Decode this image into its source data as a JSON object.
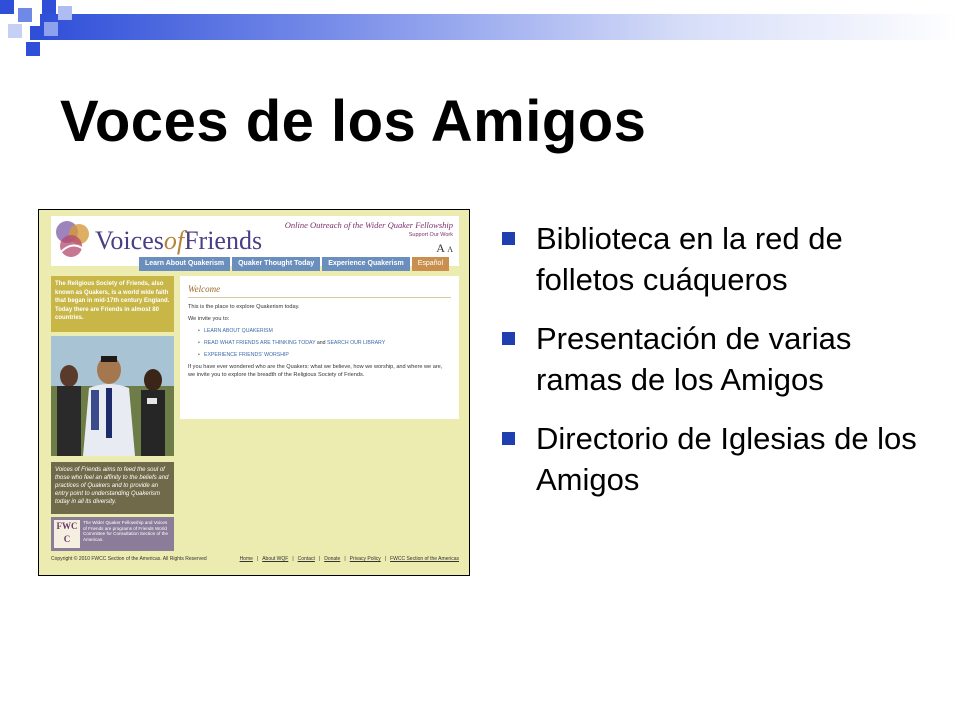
{
  "slide": {
    "title": "Voces de los Amigos",
    "accent_color": "#1f3fb0",
    "bullets": [
      {
        "text": "Biblioteca en la red de folletos cuáqueros"
      },
      {
        "text": "Presentación de varias ramas de los Amigos"
      },
      {
        "text": "Directorio de Iglesias de los Amigos"
      }
    ]
  },
  "website": {
    "logo_prefix": "Voices",
    "logo_of": "of",
    "logo_suffix": "Friends",
    "tagline": "Online Outreach of the Wider Quaker Fellowship",
    "support_link": "Support Our Work",
    "font_size_large": "A",
    "font_size_small": "A",
    "nav": [
      {
        "label": "Learn About Quakerism"
      },
      {
        "label": "Quaker Thought Today"
      },
      {
        "label": "Experience Quakerism"
      },
      {
        "label": "Español"
      }
    ],
    "intro_text": "The Religious Society of Friends, also known as Quakers, is a world wide faith that began in mid-17th century England. Today there are Friends in almost 80 countries.",
    "welcome_heading": "Welcome",
    "explore_line": "This is the place to explore Quakerism today.",
    "invite_line": "We invite you to:",
    "links": {
      "learn": "LEARN ABOUT QUAKERISM",
      "read": "READ WHAT FRIENDS ARE THINKING TODAY",
      "and": "and",
      "search": "SEARCH OUR LIBRARY",
      "experience": "EXPERIENCE FRIENDS' WORSHIP"
    },
    "wonder_paragraph": "If you have ever wondered who are the Quakers: what we believe, how we worship, and where we are, we invite you to explore the breadth of the Religious Society of Friends.",
    "mission_text": "Voices of Friends aims to feed the soul of those who feel an affinity to the beliefs and practices of Quakers and to provide an entry point to understanding Quakerism today in all its diversity.",
    "fwcc_logo": "FWC C",
    "fwcc_text": "The Wider Quaker Fellowship and Voices of Friends are programs of Friends World Committee for Consultation Section of the Americas.",
    "copyright": "Copyright © 2010 FWCC Section of the Americas. All Rights Reserved",
    "footer_links": [
      {
        "label": "Home"
      },
      {
        "label": "About WQF"
      },
      {
        "label": "Contact"
      },
      {
        "label": "Donate"
      },
      {
        "label": "Privacy Policy"
      },
      {
        "label": "FWCC Section of the Americas"
      }
    ]
  }
}
